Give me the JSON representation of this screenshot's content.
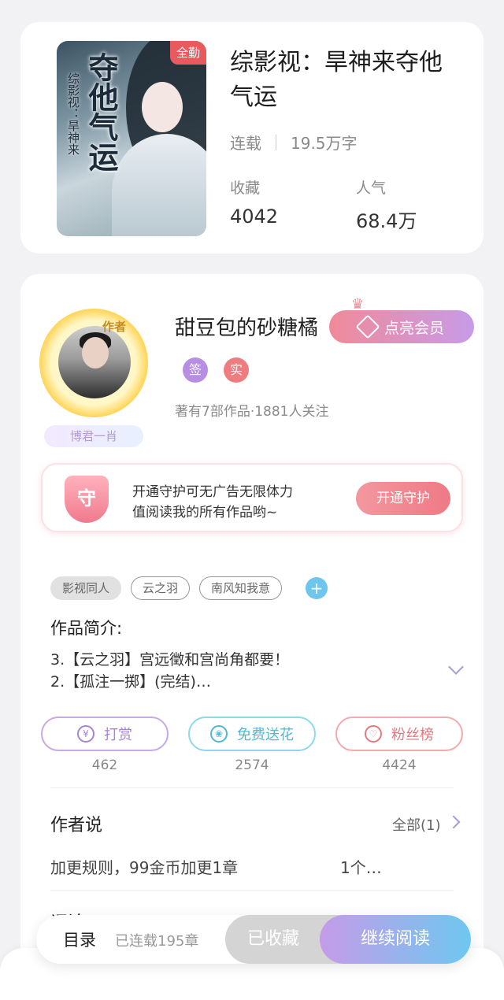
{
  "book": {
    "badge": "全勤",
    "cover_title_art": "夺他气运",
    "cover_subtitle_art": "综影视：旱神来",
    "title": "综影视：旱神来夺他气运",
    "status": "连载",
    "word_count": "19.5万字",
    "favorites_label": "收藏",
    "favorites_value": "4042",
    "popularity_label": "人气",
    "popularity_value": "68.4万"
  },
  "author": {
    "avatar_tag": "作者",
    "name_plate": "博君一肖",
    "name": "甜豆包的砂糖橘",
    "vip_label": "点亮会员",
    "tag_sign": "签",
    "tag_real": "实",
    "stats": "著有7部作品·1881人关注"
  },
  "guard": {
    "icon_text": "守",
    "line1": "开通守护可无广告无限体力",
    "line2": "值阅读我的所有作品哟~",
    "button": "开通守护"
  },
  "tags": [
    "影视同人",
    "云之羽",
    "南风知我意"
  ],
  "tag_add": "+",
  "intro": {
    "heading": "作品简介:",
    "line1": "3.【云之羽】宫远徵和宫尚角都要！",
    "line2": "2.【孤注一掷】(完结)…"
  },
  "actions": {
    "tip_label": "打赏",
    "tip_icon": "¥",
    "tip_count": "462",
    "flower_label": "免费送花",
    "flower_count": "2574",
    "fans_label": "粉丝榜",
    "fans_count": "4424"
  },
  "author_says": {
    "heading": "作者说",
    "all": "全部(1)",
    "text": "加更规则，99金币加更1章",
    "more": "1个…",
    "next_heading_clipped": "评论"
  },
  "bottom": {
    "toc": "目录",
    "toc_sub": "已连载195章",
    "saved": "已收藏",
    "read": "继续阅读"
  }
}
